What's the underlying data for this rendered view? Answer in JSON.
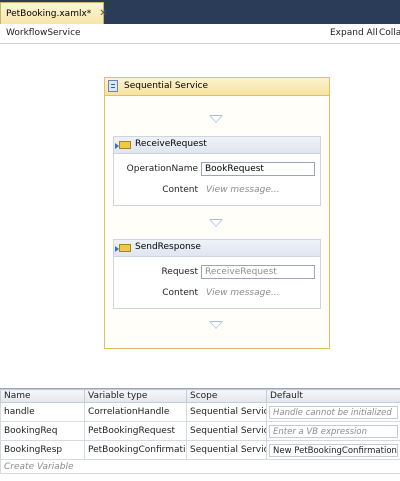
{
  "tab": {
    "label": "PetBooking.xamlx*",
    "close": "✕"
  },
  "header": {
    "breadcrumb": "WorkflowService",
    "expand_all": "Expand All",
    "collapse": "Colla"
  },
  "sequence": {
    "title": "Sequential Service",
    "receive": {
      "title": "ReceiveRequest",
      "operation_label": "OperationName",
      "operation_value": "BookRequest",
      "content_label": "Content",
      "content_value": "View message..."
    },
    "send": {
      "title": "SendResponse",
      "request_label": "Request",
      "request_value": "ReceiveRequest",
      "content_label": "Content",
      "content_value": "View message..."
    }
  },
  "variables": {
    "columns": [
      "Name",
      "Variable type",
      "Scope",
      "Default"
    ],
    "rows": [
      {
        "name": "handle",
        "type": "CorrelationHandle",
        "scope": "Sequential Service",
        "default": "Handle cannot be initialized",
        "hint": true
      },
      {
        "name": "BookingReq",
        "type": "PetBookingRequest",
        "scope": "Sequential Service",
        "default": "Enter a VB expression",
        "hint": true
      },
      {
        "name": "BookingResp",
        "type": "PetBookingConfirmation",
        "scope": "Sequential Service",
        "default": "New PetBookingConfirmation()",
        "hint": false
      }
    ],
    "create_label": "Create Variable"
  }
}
